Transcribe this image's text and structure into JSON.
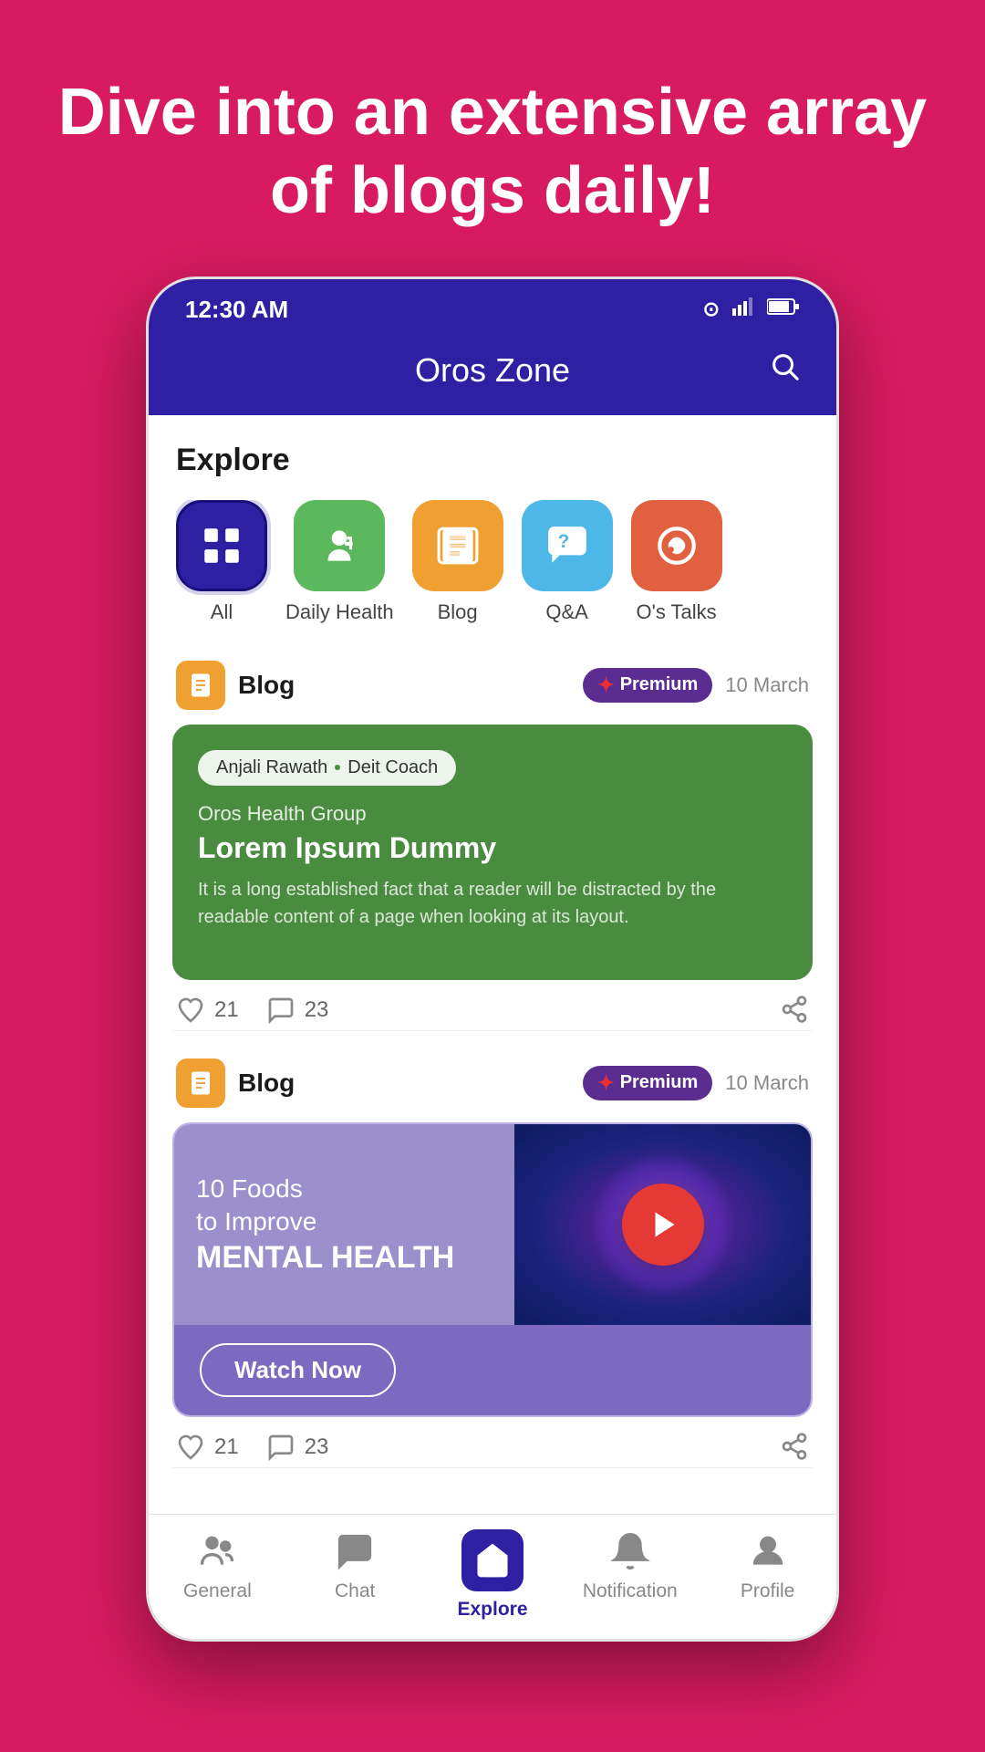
{
  "hero": {
    "title": "Dive into an extensive array of blogs daily!"
  },
  "app": {
    "title": "Oros Zone",
    "time": "12:30 AM"
  },
  "explore": {
    "label": "Explore"
  },
  "categories": [
    {
      "id": "all",
      "label": "All",
      "type": "all"
    },
    {
      "id": "daily-health",
      "label": "Daily Health",
      "type": "health"
    },
    {
      "id": "blog",
      "label": "Blog",
      "type": "blog"
    },
    {
      "id": "qa",
      "label": "Q&A",
      "type": "qa"
    },
    {
      "id": "os-talks",
      "label": "O's Talks",
      "type": "talks"
    }
  ],
  "card1": {
    "type": "Blog",
    "badge": "Premium",
    "date": "10 March",
    "author": "Anjali Rawath",
    "role": "Deit Coach",
    "group": "Oros Health Group",
    "title": "Lorem Ipsum Dummy",
    "excerpt": "It is a long established fact that a reader will be distracted by the readable content of a page when looking at its layout.",
    "likes": "21",
    "comments": "23"
  },
  "card2": {
    "type": "Blog",
    "badge": "Premium",
    "date": "10 March",
    "video_text_1": "10 Foods",
    "video_text_2": "to Improve",
    "video_text_3": "MENTAL HEALTH",
    "watch_label": "Watch Now",
    "likes": "21",
    "comments": "23"
  },
  "bottomnav": {
    "general": "General",
    "chat": "Chat",
    "explore": "Explore",
    "notification": "Notification",
    "profile": "Profile"
  }
}
